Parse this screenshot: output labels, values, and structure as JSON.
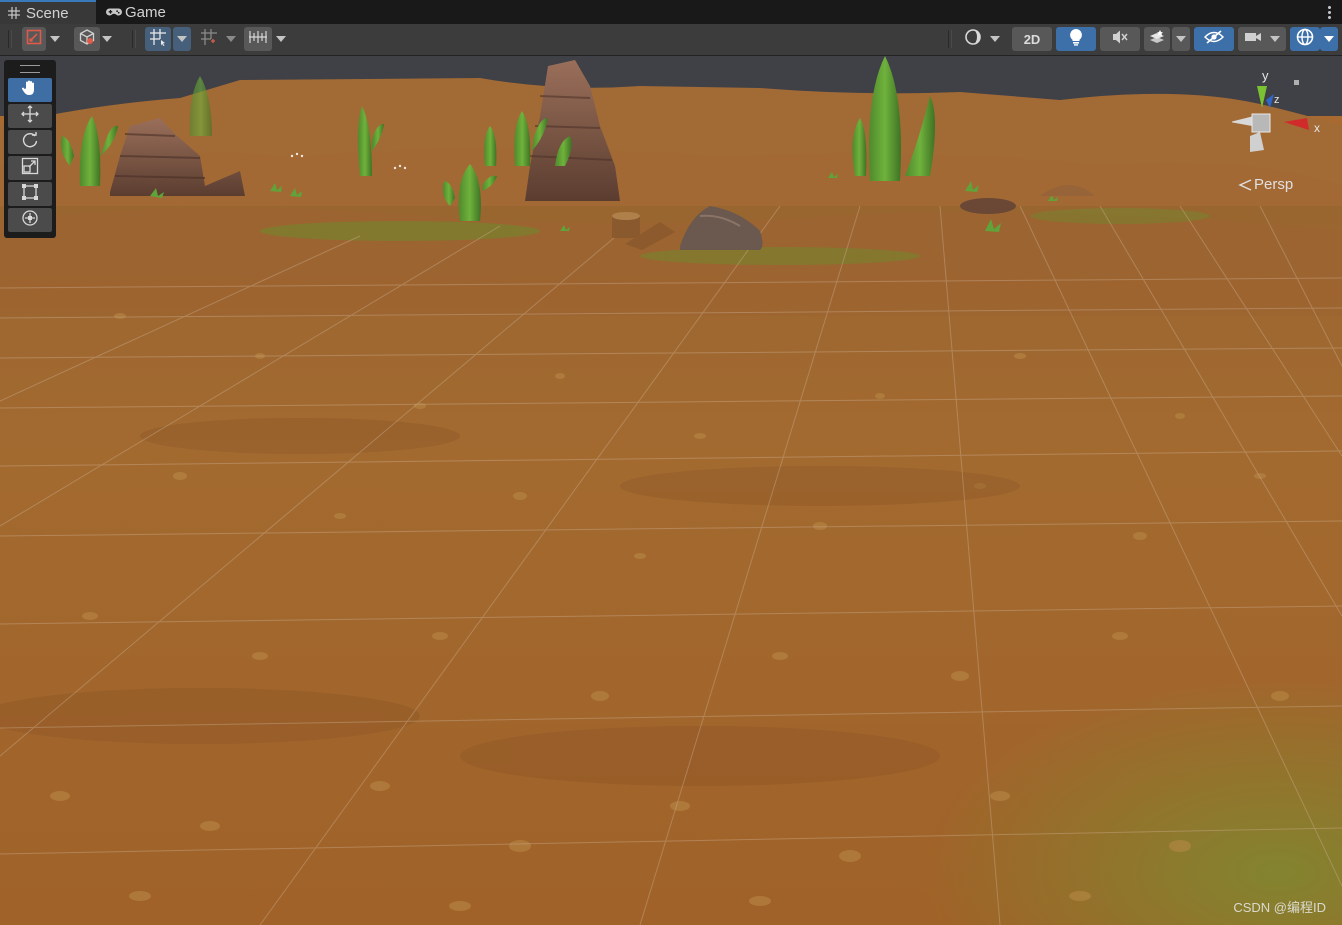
{
  "tabs": [
    {
      "label": "Scene",
      "icon": "hash-icon",
      "active": true
    },
    {
      "label": "Game",
      "icon": "gamepad-icon",
      "active": false
    }
  ],
  "toolbar": {
    "left_tools": [
      "draw-mode-icon",
      "cube-icon",
      "grid-snap-icon",
      "increment-snap-icon",
      "ruler-icon"
    ],
    "right_tools": [
      "render-mode-icon",
      "2d-toggle",
      "light-bulb-icon",
      "audio-mute-icon",
      "effects-layers-icon",
      "visibility-icon",
      "camera-icon",
      "gizmos-icon"
    ],
    "toggle_2d_label": "2D"
  },
  "tools": [
    "hand-tool",
    "move-tool",
    "rotate-tool",
    "scale-tool",
    "rect-tool",
    "transform-tool"
  ],
  "gizmo": {
    "y_label": "y",
    "z_label": "z",
    "x_label": "x",
    "projection": "Persp"
  },
  "watermark": "CSDN @编程ID",
  "colors": {
    "accent": "#3d6fa8",
    "ground": "#a86a30",
    "axis_x": "#d12a2a",
    "axis_y": "#7ac232",
    "axis_z": "#2f68c6"
  }
}
